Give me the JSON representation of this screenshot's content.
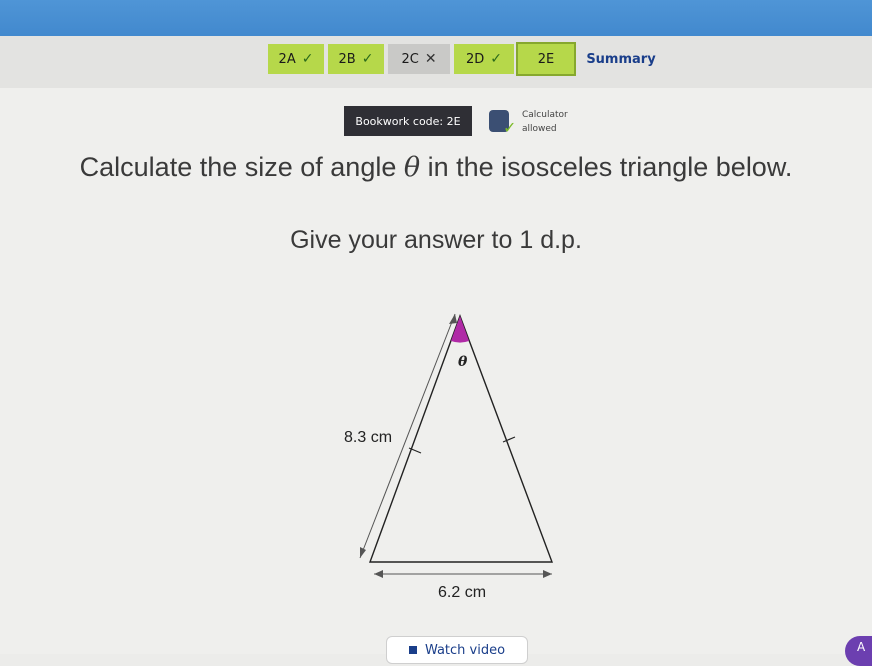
{
  "tabs": [
    {
      "label": "2A",
      "status": "tick"
    },
    {
      "label": "2B",
      "status": "tick"
    },
    {
      "label": "2C",
      "status": "cross"
    },
    {
      "label": "2D",
      "status": "tick"
    },
    {
      "label": "2E",
      "status": "current"
    },
    {
      "label": "Summary",
      "status": "summary"
    }
  ],
  "marks": {
    "tick": "✓",
    "cross": "✕"
  },
  "bookwork": {
    "label": "Bookwork code: 2E"
  },
  "calculator": {
    "line1": "Calculator",
    "line2": "allowed"
  },
  "question": {
    "line1_before": "Calculate the size of angle ",
    "theta": "θ",
    "line1_after": " in the isosceles triangle below.",
    "line2": "Give your answer to 1 d.p."
  },
  "diagram": {
    "side_label": "8.3 cm",
    "base_label": "6.2 cm",
    "angle_label": "θ",
    "angle_color": "#b02aa6"
  },
  "video": {
    "label": "Watch video"
  },
  "corner": {
    "label": "A"
  }
}
